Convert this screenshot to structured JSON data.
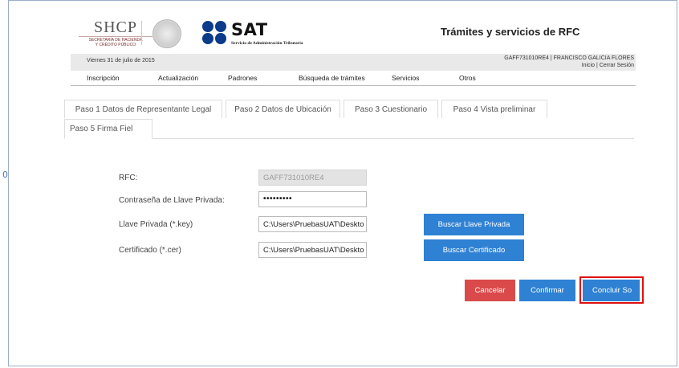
{
  "header": {
    "shcp_title": "SHCP",
    "shcp_subtitle_1": "SECRETARÍA DE HACIENDA",
    "shcp_subtitle_2": "Y CRÉDITO PÚBLICO",
    "sat_title": "SAT",
    "sat_subtitle": "Servicio de Administración Tributaria",
    "page_title": "Trámites y servicios de RFC"
  },
  "infobar": {
    "date": "Viernes 31 de julio de 2015",
    "user": "GAFF731010RE4 | FRANCISCO GALICIA FLORES",
    "link_inicio": "Inicio",
    "link_sep": "|",
    "link_logout": "Cerrar Sesión"
  },
  "menu": {
    "items": [
      "Inscripción",
      "Actualización",
      "Padrones",
      "Búsqueda de trámites",
      "Servicios",
      "Otros"
    ]
  },
  "tabs": [
    "Paso 1 Datos de Representante Legal",
    "Paso 2 Datos de Ubicación",
    "Paso 3 Cuestionario",
    "Paso 4 Vista preliminar",
    "Paso 5 Firma Fiel"
  ],
  "form": {
    "rfc_label": "RFC:",
    "rfc_value": "GAFF731010RE4",
    "password_label": "Contraseña de Llave Privada:",
    "password_value": "•••••••••",
    "key_label": "Llave Privada (*.key)",
    "key_value": "C:\\Users\\PruebasUAT\\Deskto",
    "cert_label": "Certificado (*.cer)",
    "cert_value": "C:\\Users\\PruebasUAT\\Deskto",
    "browse_key_button": "Buscar Llave Privada",
    "browse_cert_button": "Buscar Certificado"
  },
  "actions": {
    "cancel": "Cancelar",
    "confirm": "Confirmar",
    "conclude": "Concluir So"
  },
  "left_mark": "0",
  "colors": {
    "primary_blue": "#2e81d3",
    "cancel_red": "#da4a4a",
    "highlight_red": "#e01010",
    "sat_blue": "#0b3b8a"
  }
}
